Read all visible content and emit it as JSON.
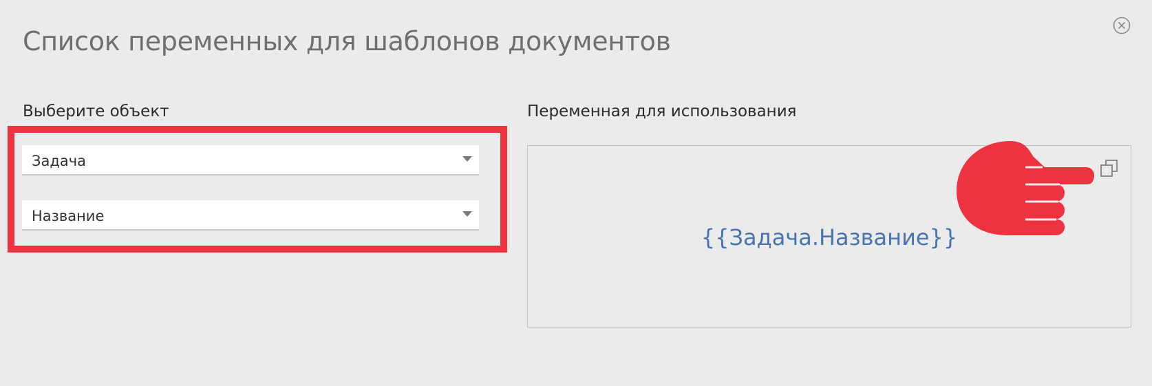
{
  "dialog": {
    "title": "Список переменных для шаблонов документов"
  },
  "left_panel": {
    "label": "Выберите объект",
    "object_select": {
      "value": "Задача"
    },
    "field_select": {
      "value": "Название"
    }
  },
  "right_panel": {
    "label": "Переменная для использования",
    "variable": "{{Задача.Название}}"
  },
  "icons": {
    "close": "close-circle-icon",
    "copy": "copy-icon",
    "caret": "caret-down-icon",
    "pointer": "pointing-hand-icon"
  },
  "colors": {
    "highlight": "#ee3340",
    "variable_text": "#4a73b1",
    "background": "#ebebeb"
  }
}
